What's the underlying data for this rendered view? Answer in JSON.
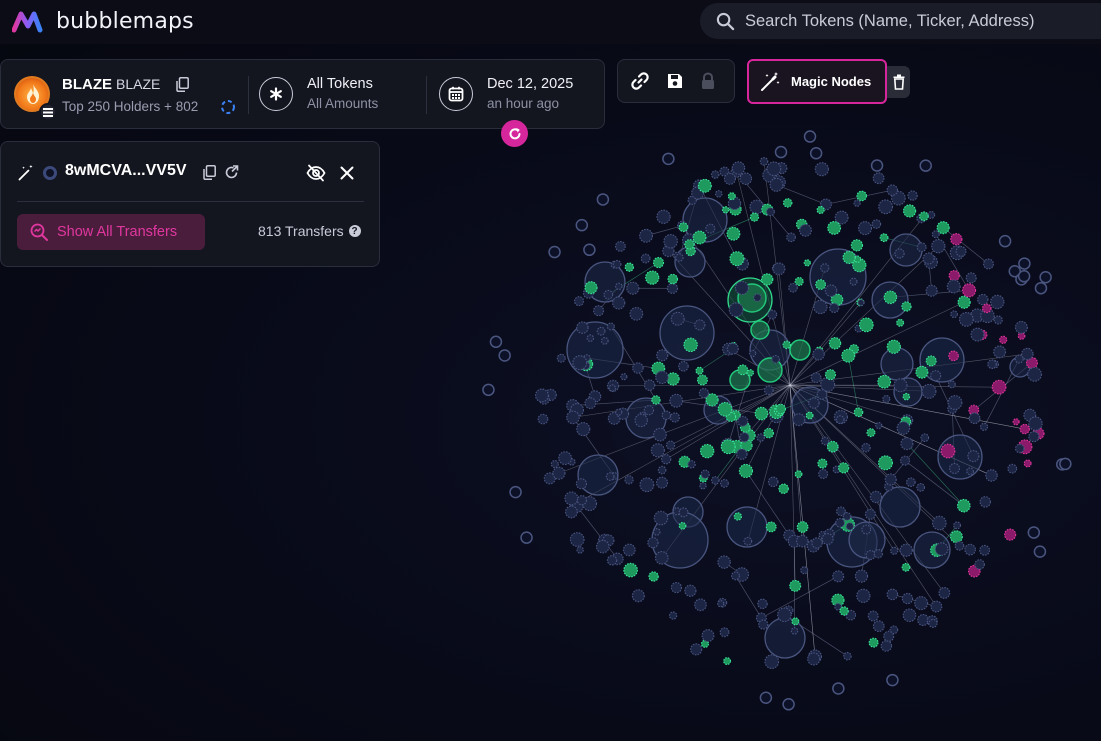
{
  "app": {
    "name": "bubblemaps"
  },
  "search": {
    "placeholder": "Search Tokens (Name, Ticker, Address)"
  },
  "token": {
    "name": "BLAZE",
    "ticker": "BLAZE",
    "holders_label": "Top 250 Holders + 802",
    "filter_label": "All Tokens",
    "filter_sub": "All Amounts",
    "date": "Dec 12, 2025",
    "date_sub": "an hour ago"
  },
  "toolbar": {
    "magic_nodes_label": "Magic Nodes"
  },
  "wallet": {
    "address": "8wMCVA...VV5V",
    "show_transfers_label": "Show All Transfers",
    "transfers_count": "813 Transfers"
  },
  "colors": {
    "accent": "#d6269b",
    "node_default": "#1e2a4a",
    "node_highlight": "#22c77a",
    "node_magenta": "#c0208f"
  },
  "icons": [
    "logo-icon",
    "search-icon",
    "flame-icon",
    "solana-icon",
    "copy-icon",
    "spinner-icon",
    "asterisk-icon",
    "calendar-icon",
    "refresh-icon",
    "link-icon",
    "save-icon",
    "lock-icon",
    "magic-wand-icon",
    "trash-icon",
    "hidden-eye-icon",
    "close-icon",
    "search-transfers-icon",
    "help-icon"
  ]
}
